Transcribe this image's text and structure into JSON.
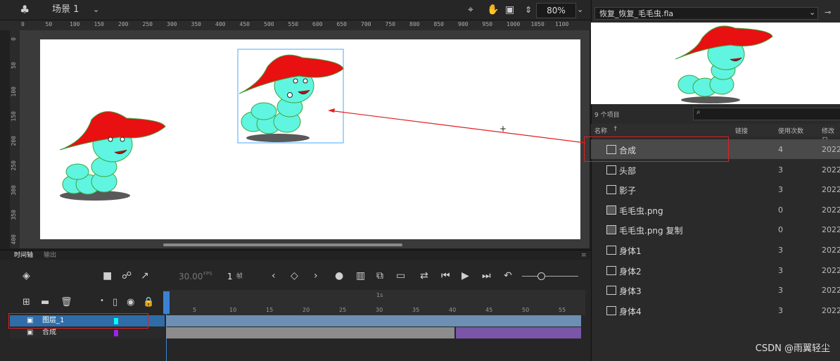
{
  "topbar": {
    "scene": "场景 1",
    "zoom": "80%"
  },
  "ruler": {
    "h_ticks": [
      "0",
      "50",
      "100",
      "150",
      "200",
      "250",
      "300",
      "350",
      "400",
      "450",
      "500",
      "550",
      "600",
      "650",
      "700",
      "750",
      "800",
      "850",
      "900",
      "950",
      "1000",
      "1050",
      "1100"
    ],
    "v_ticks": [
      "0",
      "50",
      "100",
      "150",
      "200",
      "250",
      "300",
      "350",
      "400"
    ]
  },
  "timeline": {
    "tabs": [
      "时间轴",
      "输出"
    ],
    "fps": "30.00",
    "fps_unit": "FPS",
    "frame": "1",
    "frame_unit": "帧",
    "second_marker": "1s",
    "frame_numbers": [
      "5",
      "10",
      "15",
      "20",
      "25",
      "30",
      "35",
      "40",
      "45",
      "50",
      "55"
    ],
    "layers": [
      {
        "name": "图层_1",
        "color": "#00ffff"
      },
      {
        "name": "合成",
        "color": "#a020f0"
      }
    ]
  },
  "library": {
    "file": "恢复_恢复_毛毛虫.fla",
    "item_count": "9 个项目",
    "columns": [
      "名称",
      "链接",
      "使用次数",
      "修改日"
    ],
    "items": [
      {
        "name": "合成",
        "type": "movieclip",
        "uses": "4",
        "date": "2022"
      },
      {
        "name": "头部",
        "type": "movieclip",
        "uses": "3",
        "date": "2022"
      },
      {
        "name": "影子",
        "type": "movieclip",
        "uses": "3",
        "date": "2022"
      },
      {
        "name": "毛毛虫.png",
        "type": "bitmap",
        "uses": "0",
        "date": "2022"
      },
      {
        "name": "毛毛虫.png 复制",
        "type": "bitmap",
        "uses": "0",
        "date": "2022"
      },
      {
        "name": "身体1",
        "type": "movieclip",
        "uses": "3",
        "date": "2022"
      },
      {
        "name": "身体2",
        "type": "movieclip",
        "uses": "3",
        "date": "2022"
      },
      {
        "name": "身体3",
        "type": "movieclip",
        "uses": "3",
        "date": "2022"
      },
      {
        "name": "身体4",
        "type": "movieclip",
        "uses": "3",
        "date": "2022"
      }
    ]
  },
  "watermark": "CSDN @雨翼轻尘",
  "colors": {
    "annotation_red": "#e02020",
    "selection_blue": "#2f6ca8",
    "hat_red": "#e81010",
    "body_cyan": "#5ff5e0"
  }
}
